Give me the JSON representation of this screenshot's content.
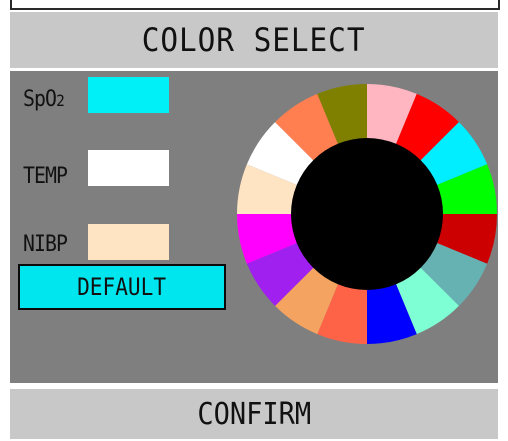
{
  "title": "COLOR SELECT",
  "parameters": [
    {
      "label_main": "SpO",
      "label_sub": "2",
      "color": "#00f0f8"
    },
    {
      "label_main": "TEMP",
      "label_sub": "",
      "color": "#ffffff"
    },
    {
      "label_main": "NIBP",
      "label_sub": "",
      "color": "#ffe4c4"
    }
  ],
  "default_label": "DEFAULT",
  "confirm_label": "CONFIRM",
  "palette": {
    "center_color": "#000000",
    "colors": [
      "#ffb6c1",
      "#ff0000",
      "#00eeff",
      "#00ff00",
      "#cc0000",
      "#66b2b2",
      "#7fffd4",
      "#0000ff",
      "#ff6347",
      "#f4a460",
      "#a020f0",
      "#ff00ff",
      "#ffe4c4",
      "#ffffff",
      "#ff7f50",
      "#808000"
    ]
  }
}
